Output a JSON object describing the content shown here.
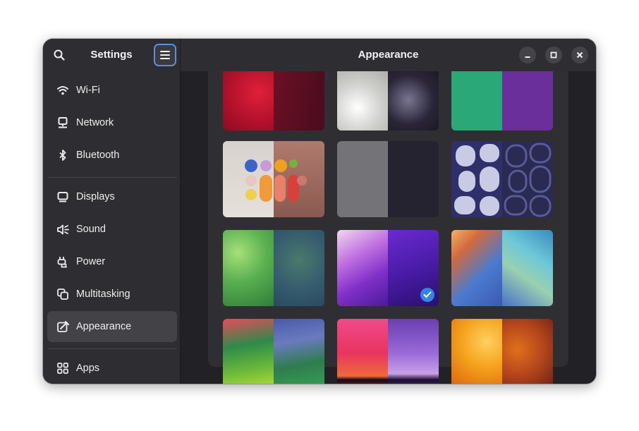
{
  "sidebar": {
    "title": "Settings",
    "search_icon": "search-icon",
    "menu_icon": "hamburger-menu-icon",
    "items": [
      {
        "label": "Wi-Fi",
        "icon": "wifi-icon"
      },
      {
        "label": "Network",
        "icon": "network-icon"
      },
      {
        "label": "Bluetooth",
        "icon": "bluetooth-icon"
      },
      {
        "label": "Displays",
        "icon": "display-icon"
      },
      {
        "label": "Sound",
        "icon": "speaker-icon"
      },
      {
        "label": "Power",
        "icon": "power-plug-icon"
      },
      {
        "label": "Multitasking",
        "icon": "multitasking-icon"
      },
      {
        "label": "Appearance",
        "icon": "appearance-icon",
        "selected": true
      },
      {
        "label": "Apps",
        "icon": "apps-grid-icon"
      }
    ]
  },
  "header": {
    "title": "Appearance",
    "buttons": [
      "minimize-icon",
      "maximize-icon",
      "close-icon"
    ]
  },
  "wallpapers": {
    "selected_index": 7,
    "items": [
      {
        "name": "red-waves",
        "light": "#c41a2b",
        "dark": "#6e1024"
      },
      {
        "name": "crystals",
        "light": "#cfcfcc",
        "dark": "#1e1c2a"
      },
      {
        "name": "green-purple",
        "light": "#2aa877",
        "dark": "#6b2f9c"
      },
      {
        "name": "pills-3d",
        "light": "#d9d3cf",
        "dark": "#9b6c60"
      },
      {
        "name": "plain-grey",
        "light": "#747478",
        "dark": "#262330"
      },
      {
        "name": "blob-maze",
        "light": "#c9cbe4",
        "dark": "#2f2f5e"
      },
      {
        "name": "blur-green",
        "light": "#6ab95a",
        "dark": "#3d6b73"
      },
      {
        "name": "purple-mountains",
        "light": "#8c3fcf",
        "dark": "#4a1f9e"
      },
      {
        "name": "light-rays",
        "light": "#f5a35a",
        "dark": "#6cb0d6"
      },
      {
        "name": "sonoma-hills",
        "light": "#7ec23a",
        "dark": "#2e7d4d"
      },
      {
        "name": "sunset-lake",
        "light": "#e8345f",
        "dark": "#6a3fb0"
      },
      {
        "name": "orange-petals",
        "light": "#f59d1d",
        "dark": "#b5451c"
      }
    ]
  },
  "colors": {
    "accent": "#3584e4",
    "window_bg": "#222226",
    "sidebar_bg": "#2e2e32"
  }
}
